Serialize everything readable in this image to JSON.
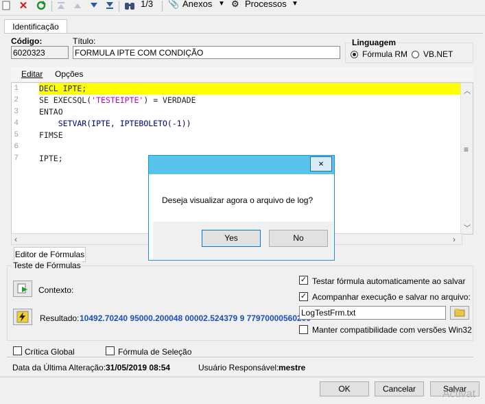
{
  "toolbar": {
    "record_counter": "1/3",
    "anexos_label": "Anexos",
    "processos_label": "Processos"
  },
  "tabs": {
    "identificacao": "Identificação"
  },
  "form": {
    "codigo_label": "Código:",
    "codigo_value": "6020323",
    "titulo_label": "Título:",
    "titulo_value": "FORMULA IPTE COM CONDIÇÃO",
    "linguagem_label": "Linguagem",
    "lang_formula_rm": "Fórmula RM",
    "lang_vbnet": "VB.NET"
  },
  "editor": {
    "menu_editar": "Editar",
    "menu_opcoes": "Opções",
    "line_numbers": [
      "1",
      "2",
      "3",
      "4",
      "5",
      "6",
      "7"
    ],
    "tab_label": "Editor de Fórmulas"
  },
  "teste": {
    "section_label": "Teste de Fórmulas",
    "contexto_label": "Contexto:",
    "resultado_label": "Resultado:",
    "resultado_value": "10492.70240 95000.200048 00002.524379 9 77970000560200",
    "chk_testar": "Testar fórmula automaticamente ao salvar",
    "chk_acompanhar": "Acompanhar execução e salvar no arquivo:",
    "arquivo_value": "LogTestFrm.txt",
    "chk_manter": "Manter compatibilidade com versões Win32"
  },
  "bottom": {
    "critica_global": "Crítica Global",
    "formula_selecao": "Fórmula de Seleção",
    "data_label": "Data da Última Alteração:",
    "data_value": "31/05/2019 08:54",
    "usuario_label": "Usuário Responsável:",
    "usuario_value": "mestre"
  },
  "footer": {
    "ok": "OK",
    "cancelar": "Cancelar",
    "salvar": "Salvar",
    "watermark": "Activat"
  },
  "dialog": {
    "close": "×",
    "message": "Deseja visualizar agora o arquivo de log?",
    "yes": "Yes",
    "no": "No"
  },
  "colors": {
    "highlight": "#ffff00",
    "dialog_title": "#58c4ec",
    "result_text": "#1a4fbf"
  }
}
